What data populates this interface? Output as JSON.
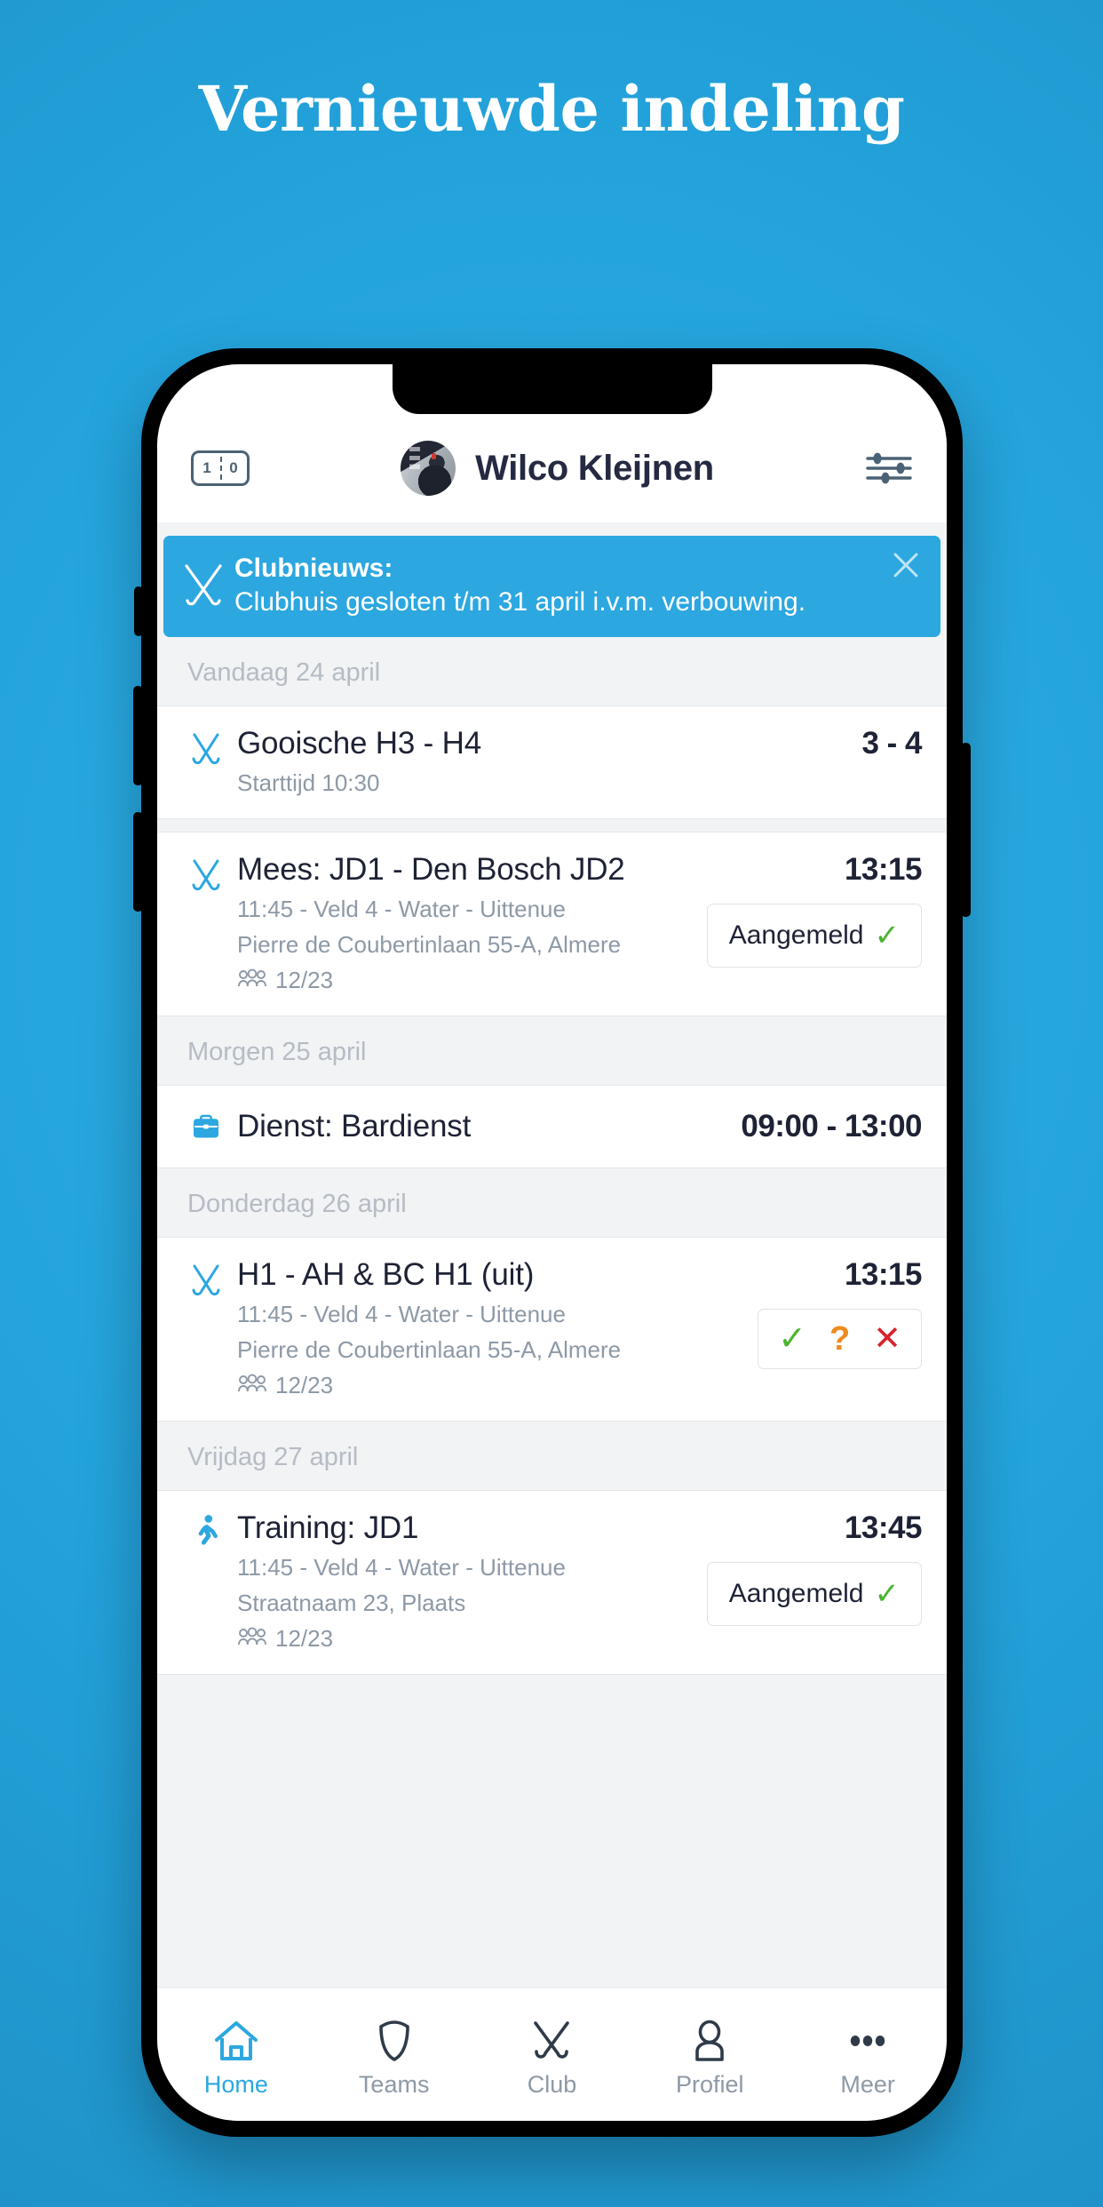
{
  "page": {
    "headline": "Vernieuwde indeling",
    "background_color": "#27a8e0"
  },
  "app": {
    "header": {
      "scoreboard_icon": {
        "name": "scoreboard-icon",
        "left_value": "1",
        "right_value": "0"
      },
      "user_name": "Wilco Kleijnen",
      "avatar": "user-avatar",
      "settings_icon": "sliders-icon"
    },
    "banner": {
      "icon": "hockey-sticks-icon",
      "title": "Clubnieuws:",
      "message": "Clubhuis gesloten t/m 31 april i.v.m. verbouwing.",
      "close_icon": "close-icon",
      "color": "#2ca7e0"
    },
    "sections": [
      {
        "day_label": "Vandaag 24 april",
        "events": [
          {
            "icon": "hockey-sticks-icon",
            "title": "Gooische H3 - H4",
            "sub1": "Starttijd 10:30",
            "sub2": "",
            "attendance": "",
            "right_value": "3 - 4",
            "action": "none"
          }
        ]
      },
      {
        "day_label": "",
        "events": [
          {
            "icon": "hockey-sticks-icon",
            "title": "Mees: JD1 - Den Bosch JD2",
            "sub1": "11:45 - Veld 4 - Water - Uittenue",
            "sub2": "Pierre de Coubertinlaan 55-A, Almere",
            "attendance": "12/23",
            "right_value": "13:15",
            "action": "status",
            "status_label": "Aangemeld"
          }
        ]
      },
      {
        "day_label": "Morgen 25 april",
        "events": [
          {
            "icon": "briefcase-icon",
            "title": "Dienst: Bardienst",
            "sub1": "",
            "sub2": "",
            "attendance": "",
            "right_value": "09:00 - 13:00",
            "action": "none"
          }
        ]
      },
      {
        "day_label": "Donderdag 26 april",
        "events": [
          {
            "icon": "hockey-sticks-icon",
            "title": "H1 - AH & BC H1 (uit)",
            "sub1": "11:45 - Veld 4 - Water - Uittenue",
            "sub2": "Pierre de Coubertinlaan 55-A, Almere",
            "attendance": "12/23",
            "right_value": "13:15",
            "action": "rsvp",
            "rsvp": {
              "yes": "✓",
              "maybe": "?",
              "no": "✕"
            }
          }
        ]
      },
      {
        "day_label": "Vrijdag 27 april",
        "events": [
          {
            "icon": "running-icon",
            "title": "Training: JD1",
            "sub1": "11:45 - Veld 4 - Water - Uittenue",
            "sub2": "Straatnaam 23, Plaats",
            "attendance": "12/23",
            "right_value": "13:45",
            "action": "status",
            "status_label": "Aangemeld"
          }
        ]
      }
    ],
    "tabbar": [
      {
        "label": "Home",
        "icon": "home-icon",
        "active": true
      },
      {
        "label": "Teams",
        "icon": "shield-icon",
        "active": false
      },
      {
        "label": "Club",
        "icon": "hockey-sticks-icon",
        "active": false
      },
      {
        "label": "Profiel",
        "icon": "person-icon",
        "active": false
      },
      {
        "label": "Meer",
        "icon": "ellipsis-icon",
        "active": false
      }
    ],
    "colors": {
      "accent": "#2ca7e0",
      "text_dark": "#1e2235",
      "text_muted": "#8d99a6",
      "green": "#4cb432",
      "orange": "#f08a1e",
      "red": "#d8232a"
    }
  }
}
